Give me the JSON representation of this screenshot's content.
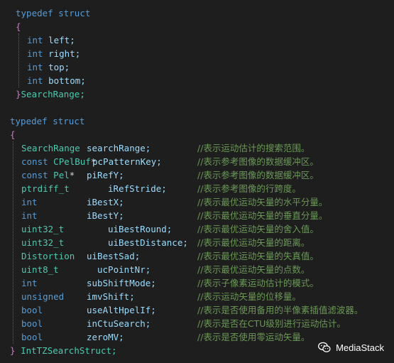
{
  "struct1": {
    "typedef": "typedef",
    "struct": "struct",
    "open": "{",
    "close": "}",
    "name": "SearchRange;",
    "fields": [
      {
        "type": "int",
        "name": "left;"
      },
      {
        "type": "int",
        "name": "right;"
      },
      {
        "type": "int",
        "name": "top;"
      },
      {
        "type": "int",
        "name": "bottom;"
      }
    ]
  },
  "struct2": {
    "typedef": "typedef",
    "struct": "struct",
    "open": "{",
    "close": "}",
    "name": "IntTZSearchStruct;",
    "fields": [
      {
        "type": "SearchRange",
        "name": "searchRange;",
        "comment": "//表示运动估计的搜索范围。"
      },
      {
        "type": "const CPelBuf*",
        "name": "pcPatternKey;",
        "comment": "//表示参考图像的数据缓冲区。"
      },
      {
        "type": "const Pel*",
        "name": "piRefY;",
        "comment": "//表示参考图像的数据缓冲区。"
      },
      {
        "type": "ptrdiff_t",
        "name": "iRefStride;",
        "comment": "//表示参考图像的行跨度。"
      },
      {
        "type": "int",
        "name": "iBestX;",
        "comment": "//表示最优运动矢量的水平分量。"
      },
      {
        "type": "int",
        "name": "iBestY;",
        "comment": "//表示最优运动矢量的垂直分量。"
      },
      {
        "type": "uint32_t",
        "name": "uiBestRound;",
        "comment": "//表示最优运动矢量的舍入值。"
      },
      {
        "type": "uint32_t",
        "name": "uiBestDistance;",
        "comment": "//表示最优运动矢量的距离。"
      },
      {
        "type": "Distortion",
        "name": "uiBestSad;",
        "comment": "//表示最优运动矢量的失真值。"
      },
      {
        "type": "uint8_t",
        "name": "ucPointNr;",
        "comment": "//表示最优运动矢量的点数。"
      },
      {
        "type": "int",
        "name": "subShiftMode;",
        "comment": "//表示子像素运动估计的模式。"
      },
      {
        "type": "unsigned",
        "name": "imvShift;",
        "comment": "//表示运动矢量的位移量。"
      },
      {
        "type": "bool",
        "name": "useAltHpelIf;",
        "comment": "//表示是否使用备用的半像素插值滤波器。"
      },
      {
        "type": "bool",
        "name": "inCtuSearch;",
        "comment": "//表示是否在CTU级别进行运动估计。"
      },
      {
        "type": "bool",
        "name": "zeroMV;",
        "comment": "//表示是否使用零运动矢量。"
      }
    ]
  },
  "watermark": {
    "icon": "wechat-icon",
    "text": "MediaStack"
  }
}
